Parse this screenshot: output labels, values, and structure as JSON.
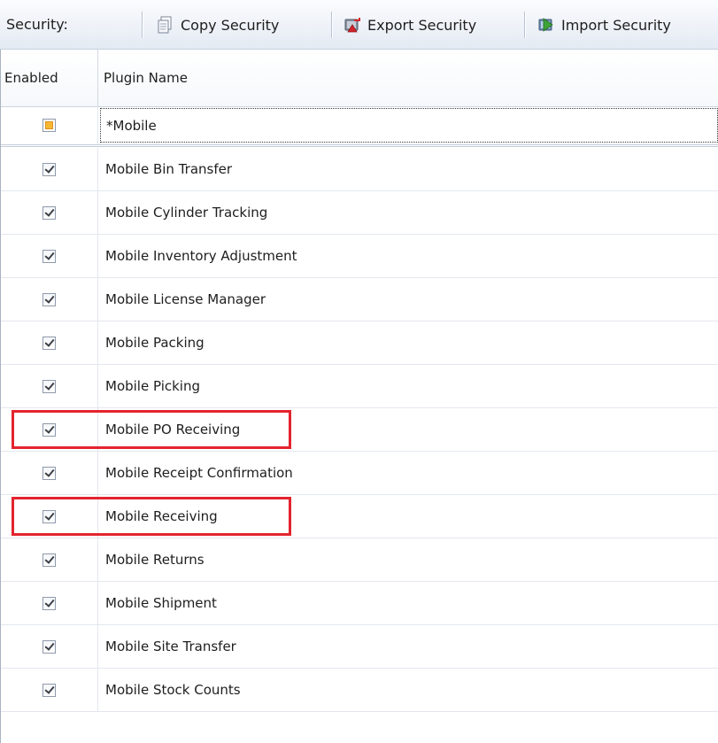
{
  "toolbar": {
    "label": "Security:",
    "buttons": [
      {
        "label": "Copy Security",
        "icon": "copy-document-icon"
      },
      {
        "label": "Export Security",
        "icon": "export-icon"
      },
      {
        "label": "Import Security",
        "icon": "import-icon"
      }
    ]
  },
  "grid": {
    "columns": [
      "Enabled",
      "Plugin Name"
    ],
    "filter_row": {
      "enabled": "indeterminate",
      "value": "*Mobile"
    },
    "rows": [
      {
        "enabled": true,
        "name": "Mobile Bin Transfer",
        "highlighted": false
      },
      {
        "enabled": true,
        "name": "Mobile Cylinder Tracking",
        "highlighted": false
      },
      {
        "enabled": true,
        "name": "Mobile Inventory Adjustment",
        "highlighted": false
      },
      {
        "enabled": true,
        "name": "Mobile License Manager",
        "highlighted": false
      },
      {
        "enabled": true,
        "name": "Mobile Packing",
        "highlighted": false
      },
      {
        "enabled": true,
        "name": "Mobile Picking",
        "highlighted": false
      },
      {
        "enabled": true,
        "name": "Mobile PO Receiving",
        "highlighted": true
      },
      {
        "enabled": true,
        "name": "Mobile Receipt Confirmation",
        "highlighted": false
      },
      {
        "enabled": true,
        "name": "Mobile Receiving",
        "highlighted": true
      },
      {
        "enabled": true,
        "name": "Mobile Returns",
        "highlighted": false
      },
      {
        "enabled": true,
        "name": "Mobile Shipment",
        "highlighted": false
      },
      {
        "enabled": true,
        "name": "Mobile Site Transfer",
        "highlighted": false
      },
      {
        "enabled": true,
        "name": "Mobile Stock Counts",
        "highlighted": false
      }
    ]
  },
  "colors": {
    "highlight_border": "#e3242f",
    "indeterminate_fill": "#f6b733"
  }
}
